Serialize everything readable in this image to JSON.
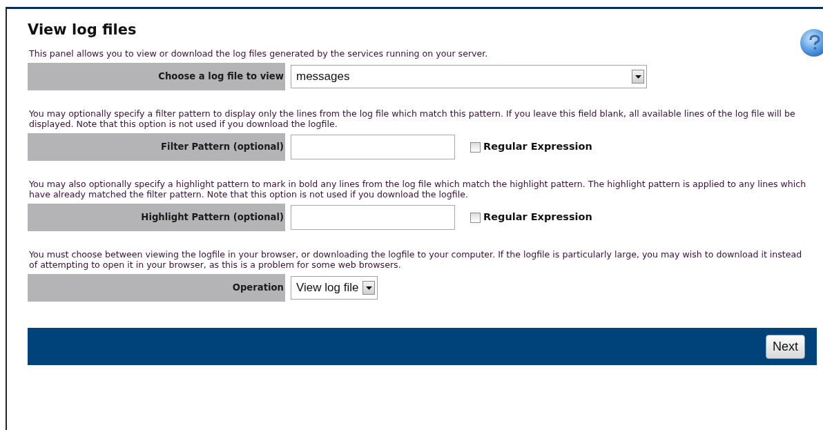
{
  "title": "View log files",
  "sections": [
    {
      "text": "This panel allows you to view or download the log files generated by the services running on your server.",
      "field": {
        "kind": "select",
        "label": "Choose a log file to view",
        "value": "messages"
      }
    },
    {
      "text": "You may optionally specify a filter pattern to display only the lines from the log file which match this pattern. If you leave this field blank, all available lines of the log file will be displayed. Note that this option is not used if you download the logfile.",
      "field": {
        "kind": "text",
        "label": "Filter Pattern (optional)",
        "checkbox": {
          "label": "Regular Expression",
          "checked": false
        }
      }
    },
    {
      "text": "You may also optionally specify a highlight pattern to mark in bold any lines from the log file which match the highlight pattern. The highlight pattern is applied to any lines which have already matched the filter pattern. Note that this option is not used if you download the logfile.",
      "field": {
        "kind": "text",
        "label": "Highlight Pattern (optional)",
        "checkbox": {
          "label": "Regular Expression",
          "checked": false
        }
      }
    },
    {
      "text": "You must choose between viewing the logfile in your browser, or downloading the logfile to your computer. If the logfile is particularly large, you may wish to download it instead of attempting to open it in your browser, as this is a problem for some web browsers.",
      "field": {
        "kind": "select",
        "label": "Operation",
        "value": "View log file"
      }
    }
  ],
  "footer": {
    "button": "Next"
  }
}
